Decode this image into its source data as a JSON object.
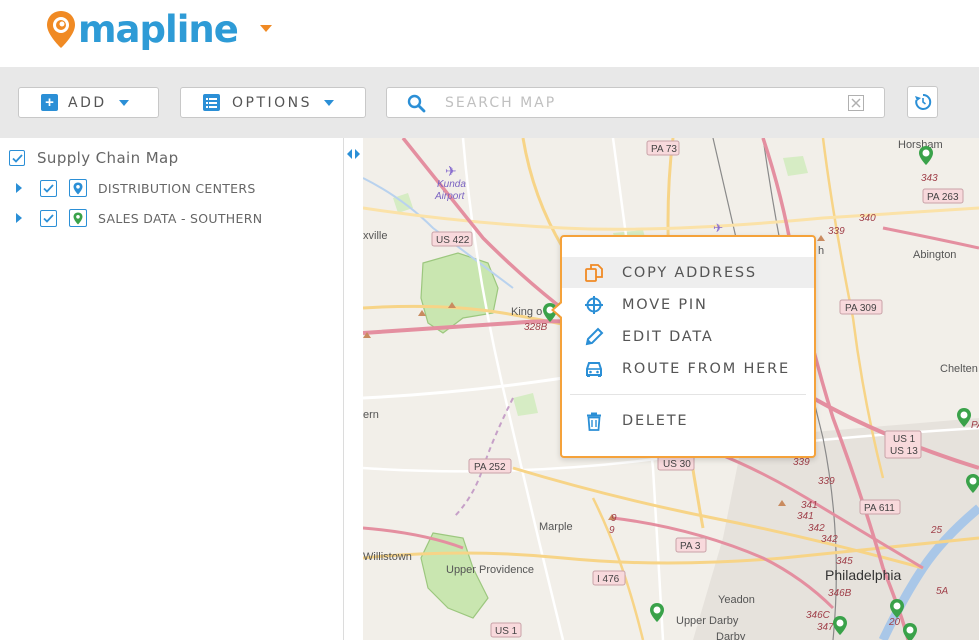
{
  "header": {
    "logo_text": "mapline"
  },
  "toolbar": {
    "add_label": "ADD",
    "options_label": "OPTIONS",
    "search_placeholder": "SEARCH MAP"
  },
  "sidebar": {
    "map_title": "Supply Chain Map",
    "layers": [
      {
        "label": "DISTRIBUTION CENTERS",
        "checked": true,
        "pin_color": "#2b8fd6"
      },
      {
        "label": "SALES DATA - SOUTHERN",
        "checked": true,
        "pin_color": "#3aa24a"
      }
    ]
  },
  "context_menu": {
    "items": [
      {
        "label": "COPY ADDRESS",
        "icon": "copy-icon"
      },
      {
        "label": "MOVE PIN",
        "icon": "crosshair-icon"
      },
      {
        "label": "EDIT DATA",
        "icon": "pencil-icon"
      },
      {
        "label": "ROUTE FROM HERE",
        "icon": "car-icon"
      },
      {
        "label": "DELETE",
        "icon": "trash-icon"
      }
    ]
  },
  "map": {
    "labels": {
      "horsham": "Horsham",
      "abington": "Abington",
      "kunda": "Kunda",
      "airport": "Airport",
      "xville": "xville",
      "king": "King o",
      "ern": "ern",
      "marple": "Marple",
      "willistown": "Willistown",
      "upper_providence": "Upper Providence",
      "yeadon": "Yeadon",
      "upper_darby": "Upper Darby",
      "darby": "Darby",
      "philadelphia": "Philadelphia",
      "chelten": "Chelten",
      "h": "h"
    },
    "shields": {
      "pa73": "PA 73",
      "pa263": "PA 263",
      "us422": "US 422",
      "pa309": "PA 309",
      "us1_us13_a": "US 1",
      "us1_us13_b": "US 13",
      "pa252": "PA 252",
      "us30": "US 30",
      "pa611": "PA 611",
      "pa3": "PA 3",
      "i476": "I 476",
      "us1": "US 1"
    },
    "route_numbers": {
      "r343": "343",
      "r340": "340",
      "r339a": "339",
      "r328b": "328B",
      "r339b": "339",
      "r339c": "339",
      "r341a": "341",
      "r341b": "341",
      "r342a": "342",
      "r342b": "342",
      "r345": "345",
      "r346b": "346B",
      "r346c": "346C",
      "r347": "347",
      "r25": "25",
      "r20": "20",
      "r5a": "5A",
      "r9a": "9",
      "r9b": "9",
      "pa_cut": "PA"
    }
  },
  "colors": {
    "brand_blue": "#2b8fd6",
    "brand_orange": "#f08a24",
    "popup_border": "#f5a23a",
    "pin_green": "#3aa24a"
  }
}
